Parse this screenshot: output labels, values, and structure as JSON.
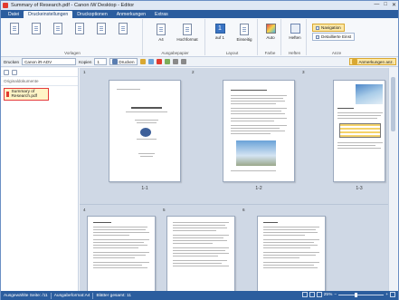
{
  "window": {
    "title": "Summary of Research.pdf - Canon iW Desktop - Editor",
    "controls": [
      "—",
      "□",
      "✕"
    ]
  },
  "tabs": [
    {
      "label": "Datei",
      "active": false
    },
    {
      "label": "Druckeinstellungen",
      "active": true
    },
    {
      "label": "Druckoptionen",
      "active": false
    },
    {
      "label": "Anmerkungen",
      "active": false
    },
    {
      "label": "Extras",
      "active": false
    }
  ],
  "ribbon": {
    "groups": {
      "vorlagen": "Vorlagen",
      "ausgabepapier": "Ausgabepapier",
      "layout": "Layout",
      "farbe": "Farbe",
      "heften": "Heften",
      "anze": "Anze"
    },
    "buttons": {
      "a4": "A4",
      "hochformat": "Hochformat",
      "auf1": "auf 1",
      "einseitig": "Einseitig",
      "auto": "Auto",
      "heften": "Heften"
    },
    "navigation": "Navigation",
    "detailed_view": "Detaillierte Einst"
  },
  "toolbar": {
    "printer_label": "Drucken",
    "printer_value": "Canon iR-ADV",
    "copies_label": "Kopien",
    "copies_value": "1",
    "print_button": "Drucken",
    "annotations_button": "Anmerkungen anz."
  },
  "sidebar": {
    "header": "Originaldokumente",
    "items": [
      {
        "label": "Summary of Research.pdf",
        "selected": true
      }
    ]
  },
  "preview": {
    "pages": [
      {
        "number": "1",
        "label": "1-1"
      },
      {
        "number": "2",
        "label": "1-2"
      },
      {
        "number": "3",
        "label": "1-3"
      },
      {
        "number": "4",
        "label": ""
      },
      {
        "number": "5",
        "label": ""
      },
      {
        "number": "6",
        "label": ""
      }
    ]
  },
  "statusbar": {
    "selected_page": "Ausgewählte Seite: /11",
    "output_format": "Ausgabeformat:A4",
    "total_sheets": "Blätter gesamt: 11",
    "zoom": "25%"
  },
  "colors": {
    "accent": "#2b5d9e",
    "selected_border": "#e53b3b",
    "highlight": "#fde8a6"
  }
}
